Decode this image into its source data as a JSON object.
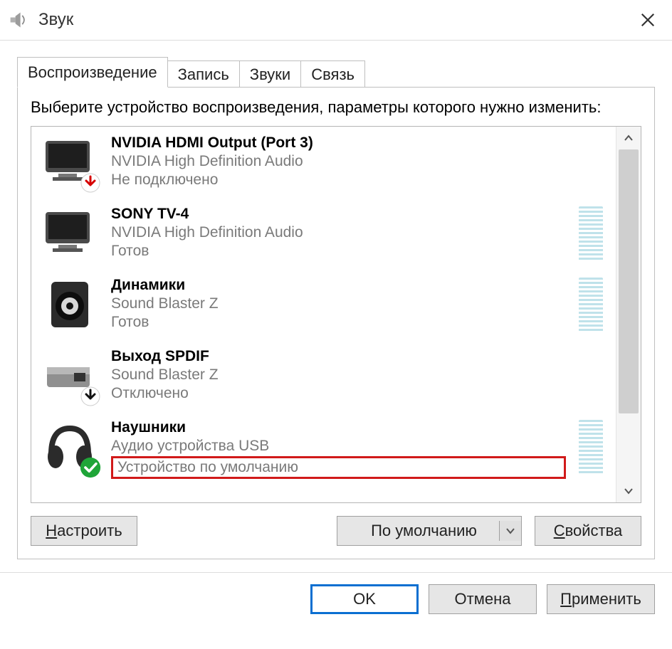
{
  "window": {
    "title": "Звук",
    "icon": "speaker-icon"
  },
  "tabs": [
    {
      "label": "Воспроизведение",
      "active": true
    },
    {
      "label": "Запись",
      "active": false
    },
    {
      "label": "Звуки",
      "active": false
    },
    {
      "label": "Связь",
      "active": false
    }
  ],
  "instruction": "Выберите устройство воспроизведения, параметры которого нужно изменить:",
  "devices": [
    {
      "icon": "monitor",
      "name": "NVIDIA HDMI Output (Port 3)",
      "driver": "NVIDIA High Definition Audio",
      "status": "Не подключено",
      "badge": "down-red",
      "meter": false,
      "highlight": false
    },
    {
      "icon": "monitor",
      "name": "SONY TV-4",
      "driver": "NVIDIA High Definition Audio",
      "status": "Готов",
      "badge": null,
      "meter": true,
      "highlight": false
    },
    {
      "icon": "speaker",
      "name": "Динамики",
      "driver": "Sound Blaster Z",
      "status": "Готов",
      "badge": null,
      "meter": true,
      "highlight": false
    },
    {
      "icon": "spdif",
      "name": "Выход SPDIF",
      "driver": "Sound Blaster Z",
      "status": "Отключено",
      "badge": "down-black",
      "meter": false,
      "highlight": false
    },
    {
      "icon": "headphones",
      "name": "Наушники",
      "driver": "Аудио устройства USB",
      "status": "Устройство по умолчанию",
      "badge": "check-green",
      "meter": true,
      "highlight": true
    }
  ],
  "panel_buttons": {
    "configure": "Настроить",
    "default": "По умолчанию",
    "properties": "Свойства"
  },
  "footer": {
    "ok": "OK",
    "cancel": "Отмена",
    "apply": "Применить"
  }
}
